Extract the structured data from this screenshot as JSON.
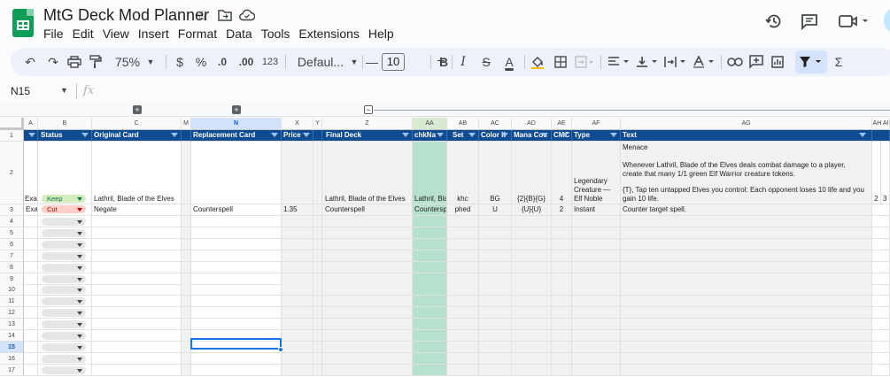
{
  "app": {
    "doc_title": "MtG Deck Mod Planner",
    "menu": [
      "File",
      "Edit",
      "View",
      "Insert",
      "Format",
      "Data",
      "Tools",
      "Extensions",
      "Help"
    ]
  },
  "toolbar": {
    "zoom": "75%",
    "currency": "$",
    "percent": "%",
    "dec_decrease": ".0",
    "dec_increase": ".00",
    "number_format": "123",
    "font": "Defaul...",
    "minus": "—",
    "font_size": "10",
    "plus": "+",
    "bold": "B",
    "italic": "I",
    "strike": "S",
    "text_color": "A",
    "sum": "Σ"
  },
  "formula_bar": {
    "cell_ref": "N15",
    "fx": "fx"
  },
  "columns": {
    "A": "A",
    "B": "B",
    "C": "C",
    "M": "M",
    "N": "N",
    "X": "X",
    "Y": "Y",
    "Z": "Z",
    "AA": "AA",
    "AB": "AB",
    "AC": "AC",
    "AD": "AD",
    "AE": "AE",
    "AF": "AF",
    "AG": "AG",
    "AH": "AH AI"
  },
  "headers": {
    "status": "Status",
    "original_card": "Original Card",
    "replacement_card": "Replacement Card",
    "price": "Price",
    "final_deck": "Final Deck",
    "check_name": "chkNa",
    "set": "Set",
    "color_id": "Color II",
    "mana_cost": "Mana Cos",
    "cmc": "CMC",
    "type": "Type",
    "text": "Text"
  },
  "rows": {
    "r2": {
      "a": "Exa",
      "status": "Keep",
      "original": "Lathril, Blade of the Elves",
      "final": "Lathril, Blade of the Elves",
      "check": "Lathril, Bla",
      "set": "khc",
      "color": "BG",
      "mana": "{2}{B}{G}",
      "cmc": "4",
      "type_l1": "Legendary",
      "type_l2": "Creature —",
      "type_l3": "Elf Noble",
      "text_l1": "Menace",
      "text_l2": "Whenever Lathril, Blade of the Elves deals combat damage to a player,",
      "text_l3": "create that many 1/1 green Elf Warrior creature tokens.",
      "text_l4": "{T}, Tap ten untapped Elves you control: Each opponent loses 10 life and you",
      "text_l5": "gain 10 life.",
      "ah": "2",
      "ai": "3"
    },
    "r3": {
      "a": "Exa",
      "status": "Cut",
      "original": "Negate",
      "replacement": "Counterspell",
      "price": "1.35",
      "final": "Counterspell",
      "check": "Countersp",
      "set": "phed",
      "color": "U",
      "mana": "{U}{U}",
      "cmc": "2",
      "type": "Instant",
      "text": "Counter target spell."
    }
  },
  "row_numbers": [
    "1",
    "2",
    "3",
    "4",
    "5",
    "6",
    "7",
    "8",
    "9",
    "10",
    "11",
    "12",
    "13",
    "14",
    "15",
    "16",
    "17"
  ],
  "colors": {
    "header_blue": "#0e4c92",
    "keep_bg": "#d4edbc",
    "cut_bg": "#ffcfc9",
    "check_green": "#b7e1cd"
  }
}
